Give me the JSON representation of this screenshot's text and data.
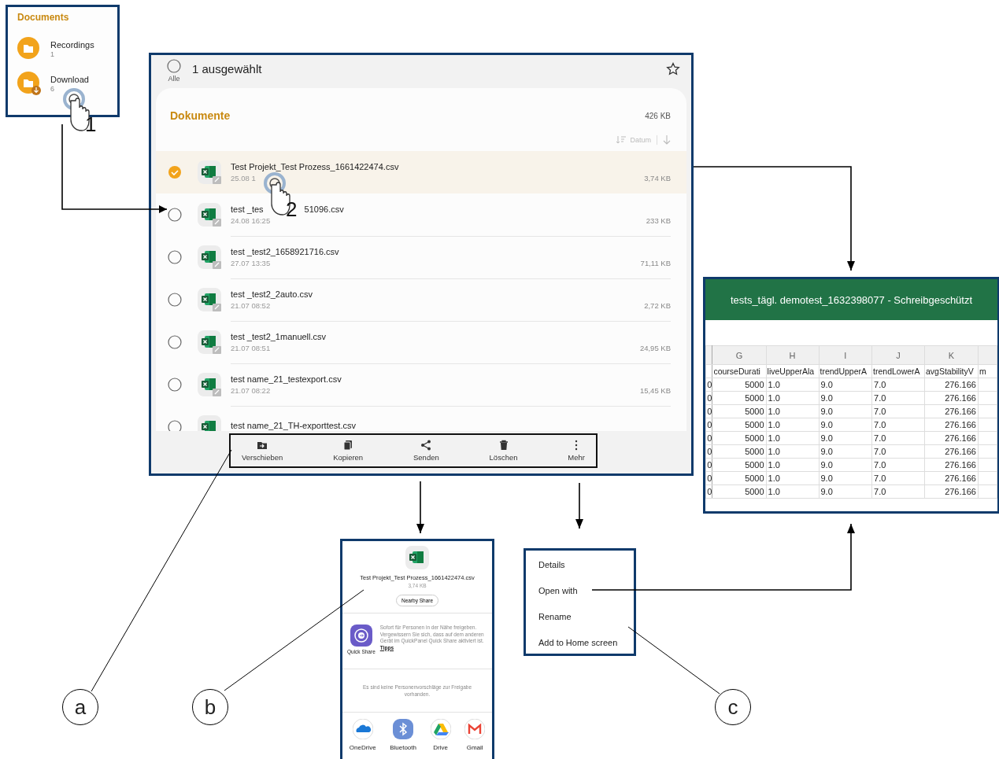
{
  "folders_panel": {
    "title": "Documents",
    "folders": [
      {
        "name": "Recordings",
        "count": "1",
        "download_badge": false
      },
      {
        "name": "Download",
        "count": "6",
        "download_badge": true
      }
    ]
  },
  "main": {
    "all_selected": false,
    "title": "1 ausgewählt",
    "select_all_label": "Alle",
    "section": "Dokumente",
    "section_size": "426 KB",
    "sort_label": "Datum",
    "files": [
      {
        "name": "Test Projekt_Test Prozess_1661422474.csv",
        "date": "25.08 1",
        "size": "3,74 KB",
        "selected": true
      },
      {
        "name": "test _tes",
        "name_tail": "51096.csv",
        "date": "24.08 16:25",
        "size": "233 KB",
        "selected": false
      },
      {
        "name": "test _test2_1658921716.csv",
        "date": "27.07 13:35",
        "size": "71,11 KB",
        "selected": false
      },
      {
        "name": "test _test2_2auto.csv",
        "date": "21.07 08:52",
        "size": "2,72 KB",
        "selected": false
      },
      {
        "name": "test _test2_1manuell.csv",
        "date": "21.07 08:51",
        "size": "24,95 KB",
        "selected": false
      },
      {
        "name": "test name_21_testexport.csv",
        "date": "21.07 08:22",
        "size": "15,45 KB",
        "selected": false
      },
      {
        "name": "test name_21_TH-exporttest.csv",
        "selected": false
      }
    ],
    "actions": [
      {
        "label": "Verschieben",
        "kind": "move"
      },
      {
        "label": "Kopieren",
        "kind": "copy"
      },
      {
        "label": "Senden",
        "kind": "share"
      },
      {
        "label": "Löschen",
        "kind": "delete"
      },
      {
        "label": "Mehr",
        "kind": "more"
      }
    ]
  },
  "touch_markers": [
    {
      "number": "1"
    },
    {
      "number": "2"
    }
  ],
  "spreadsheet": {
    "title": "tests_tägl. demotest_1632398077 - Schreibgeschützt",
    "columns": [
      "G",
      "H",
      "I",
      "J",
      "K"
    ],
    "header_row": [
      "courseDurati",
      "liveUpperAla",
      "trendUpperA",
      "trendLowerA",
      "avgStabilityV",
      "m"
    ],
    "rows": [
      {
        "edge": "0",
        "cells": [
          "5000",
          "1.0",
          "9.0",
          "7.0",
          "276.166"
        ]
      },
      {
        "edge": "0",
        "cells": [
          "5000",
          "1.0",
          "9.0",
          "7.0",
          "276.166"
        ]
      },
      {
        "edge": "0",
        "cells": [
          "5000",
          "1.0",
          "9.0",
          "7.0",
          "276.166"
        ]
      },
      {
        "edge": "0",
        "cells": [
          "5000",
          "1.0",
          "9.0",
          "7.0",
          "276.166"
        ]
      },
      {
        "edge": "0",
        "cells": [
          "5000",
          "1.0",
          "9.0",
          "7.0",
          "276.166"
        ]
      },
      {
        "edge": "0",
        "cells": [
          "5000",
          "1.0",
          "9.0",
          "7.0",
          "276.166"
        ]
      },
      {
        "edge": "0",
        "cells": [
          "5000",
          "1.0",
          "9.0",
          "7.0",
          "276.166"
        ]
      },
      {
        "edge": "0",
        "cells": [
          "5000",
          "1.0",
          "9.0",
          "7.0",
          "276.166"
        ]
      },
      {
        "edge": "0",
        "cells": [
          "5000",
          "1.0",
          "9.0",
          "7.0",
          "276.166"
        ]
      }
    ]
  },
  "share_sheet": {
    "file_name": "Test Projekt_Test Prozess_1661422474.csv",
    "file_size": "3,74 KB",
    "nearby_button": "Nearby Share",
    "quick_share_label": "Quick Share",
    "quick_share_text": "Sofort für Personen in der Nähe freigeben. Vergewissern Sie sich, dass auf dem anderen Gerät im QuickPanel Quick Share aktiviert ist. **Tipps**",
    "empty_text": "Es sind keine Personenvorschläge zur Freigabe vorhanden.",
    "apps": [
      {
        "label": "OneDrive",
        "kind": "cloud"
      },
      {
        "label": "Bluetooth",
        "kind": "bluetooth"
      },
      {
        "label": "Drive",
        "kind": "drive"
      },
      {
        "label": "Gmail",
        "kind": "mail"
      }
    ]
  },
  "context_menu": {
    "items": [
      "Details",
      "Open with",
      "Rename",
      "Add to Home screen"
    ]
  },
  "callouts": [
    "a",
    "b",
    "c"
  ]
}
